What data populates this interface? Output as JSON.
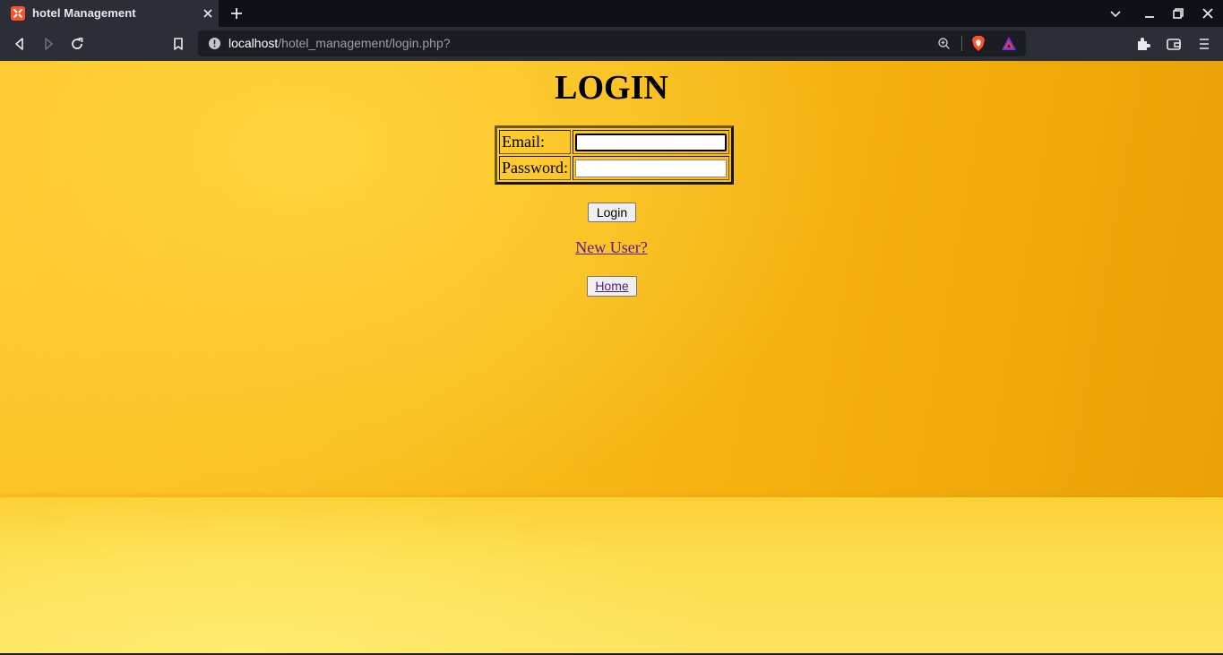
{
  "browser": {
    "tab": {
      "title": "hotel Management",
      "favicon": "xampp-icon"
    },
    "url": {
      "host": "localhost",
      "path": "/hotel_management/login.php?"
    },
    "colors": {
      "tab_bar": "#0f1117",
      "toolbar": "#2b2e36",
      "url_bar": "#1b1d23"
    }
  },
  "page": {
    "title": "LOGIN",
    "form": {
      "email_label": "Email:",
      "email_value": "",
      "password_label": "Password:",
      "password_value": ""
    },
    "login_button": "Login",
    "new_user_link": "New User?",
    "home_button": "Home",
    "colors": {
      "background": "#f9bd1c",
      "link": "#551a8b"
    }
  }
}
